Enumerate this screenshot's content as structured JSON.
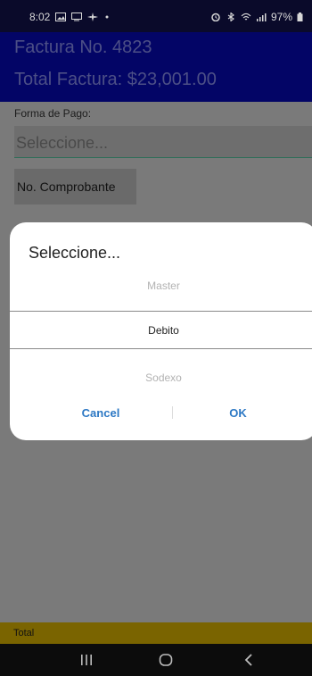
{
  "status_bar": {
    "time": "8:02",
    "battery": "97%",
    "icons_left": [
      "image-icon",
      "cast-icon",
      "fan-icon",
      "dot-icon"
    ],
    "icons_right": [
      "alarm-icon",
      "bluetooth-icon",
      "wifi-icon",
      "signal-icon",
      "battery-icon"
    ]
  },
  "header": {
    "invoice": "Factura No. 4823",
    "total": "Total Factura: $23,001.00"
  },
  "form": {
    "forma_pago_label": "Forma de Pago:",
    "picker_placeholder": "Seleccione...",
    "comprobante_label": "No. Comprobante"
  },
  "dialog": {
    "title": "Seleccione...",
    "options": [
      {
        "label": "Master",
        "selected": false
      },
      {
        "label": "Debito",
        "selected": true
      },
      {
        "label": "Sodexo",
        "selected": false
      }
    ],
    "cancel_label": "Cancel",
    "ok_label": "OK"
  },
  "footer": {
    "total_label": "Total"
  },
  "colors": {
    "header_bg": "#030566",
    "accent": "#2c78c4",
    "total_bar_bg": "#7a6400",
    "scrim": "#7a7a7a"
  }
}
